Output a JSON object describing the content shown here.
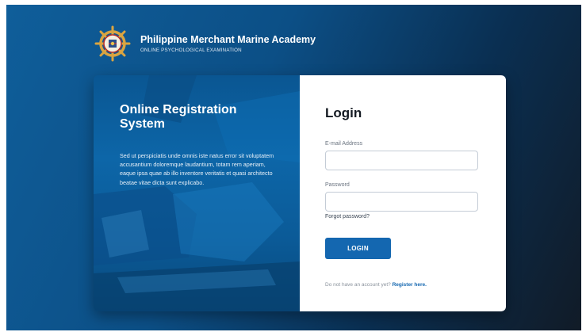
{
  "brand": {
    "title": "Philippine Merchant Marine Academy",
    "subtitle": "ONLINE PSYCHOLOGICAL EXAMINATION",
    "logo_icon": "ship-wheel-seal-icon"
  },
  "left_panel": {
    "title": "Online Registration System",
    "body": "Sed ut perspiciatis unde omnis iste natus error sit voluptatem accusantium doloremque laudantium, totam rem aperiam, eaque ipsa quae ab illo inventore veritatis et quasi architecto beatae vitae dicta sunt explicabo."
  },
  "login": {
    "title": "Login",
    "email_label": "E-mail Address",
    "email_value": "",
    "email_placeholder": "",
    "password_label": "Password",
    "password_value": "",
    "password_placeholder": "",
    "forgot_label": "Forgot password?",
    "button_label": "LOGIN",
    "register_prompt": "Do not have an account yet?",
    "register_link": "Register here."
  },
  "colors": {
    "accent": "#1467b0",
    "background_dark": "#111b27",
    "background_blue": "#0f5e9a"
  }
}
